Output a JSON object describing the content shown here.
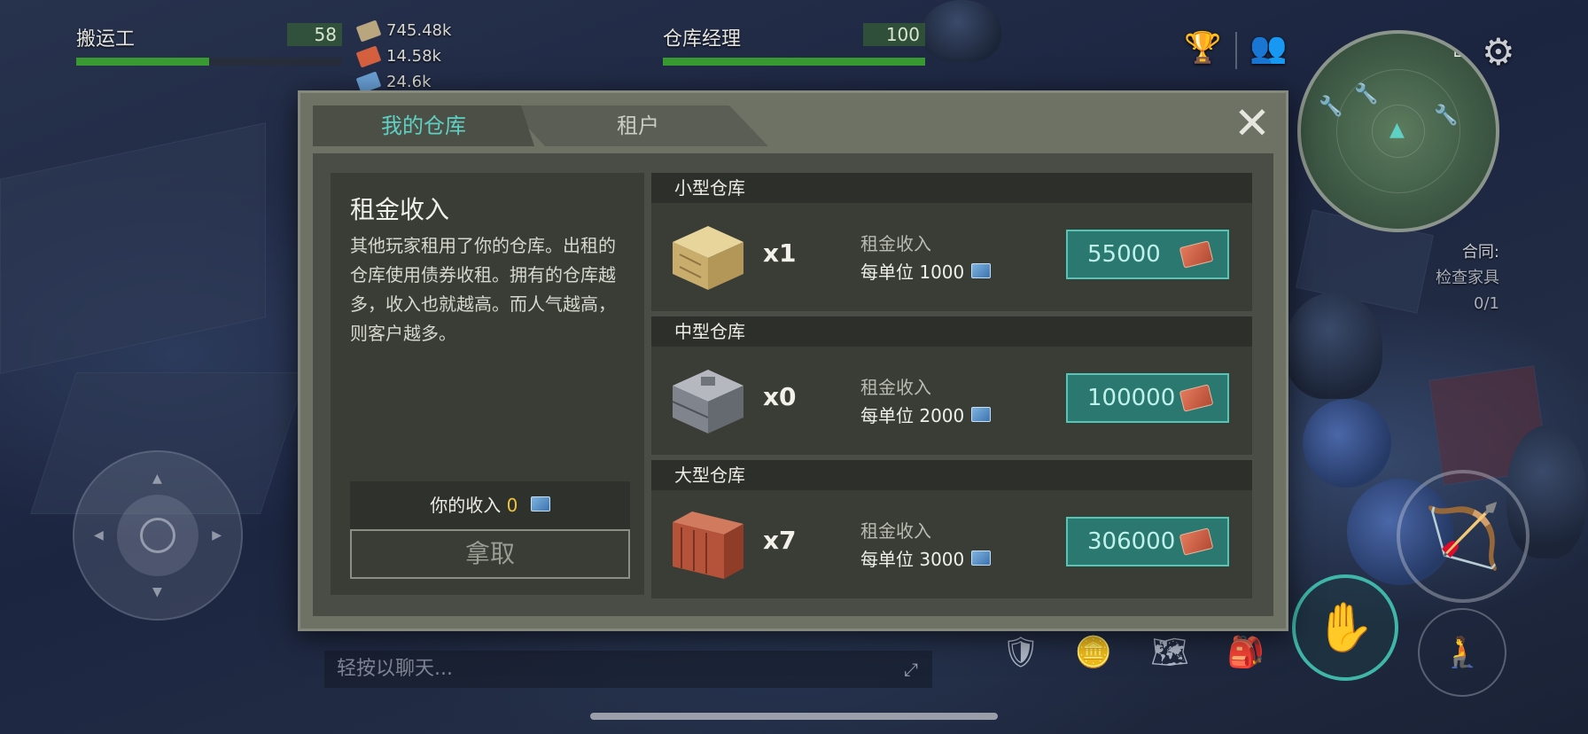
{
  "hud": {
    "left_bar": {
      "name": "搬运工",
      "level": "58",
      "progress": 0.5
    },
    "right_bar": {
      "name": "仓库经理",
      "level": "100",
      "progress": 1.0
    },
    "resources": [
      {
        "value": "745.48k",
        "icon": "wood-plank-icon",
        "color": "#b9a57e"
      },
      {
        "value": "14.58k",
        "icon": "red-ticket-icon",
        "color": "#d5603f"
      },
      {
        "value": "24.6k",
        "icon": "bond-icon",
        "color": "#6aa0d6"
      }
    ],
    "top_icons": [
      "trophy-icon",
      "friends-icon",
      "gear-icon"
    ]
  },
  "minimap": {
    "markers": [
      "wrench-icon",
      "home-icon",
      "player-icon"
    ]
  },
  "quest": {
    "title": "合同:",
    "task": "检查家具",
    "progress": "0/1"
  },
  "chat": {
    "placeholder": "轻按以聊天..."
  },
  "dialog": {
    "tabs": [
      {
        "label": "我的仓库",
        "active": true
      },
      {
        "label": "租户",
        "active": false
      }
    ],
    "info": {
      "title": "租金收入",
      "description": "其他玩家租用了你的仓库。出租的仓库使用债券收租。拥有的仓库越多，收入也就越高。而人气越高，则客户越多。",
      "income_label": "你的收入",
      "income_value": "0",
      "collect_label": "拿取"
    },
    "warehouses": [
      {
        "name": "小型仓库",
        "count": "x1",
        "income_label": "租金收入",
        "per_unit": "每单位 1000",
        "price": "55000",
        "image": "wooden-crate-icon"
      },
      {
        "name": "中型仓库",
        "count": "x0",
        "income_label": "租金收入",
        "per_unit": "每单位 2000",
        "price": "100000",
        "image": "metal-crate-icon"
      },
      {
        "name": "大型仓库",
        "count": "x7",
        "income_label": "租金收入",
        "per_unit": "每单位 3000",
        "price": "306000",
        "image": "shipping-container-icon"
      }
    ]
  },
  "colors": {
    "accent": "#5fd0c4",
    "button_bg": "#2a7870",
    "panel_bg": "#3a3c36",
    "hud_green": "#3a9a32",
    "income_value": "#f0c43a"
  }
}
